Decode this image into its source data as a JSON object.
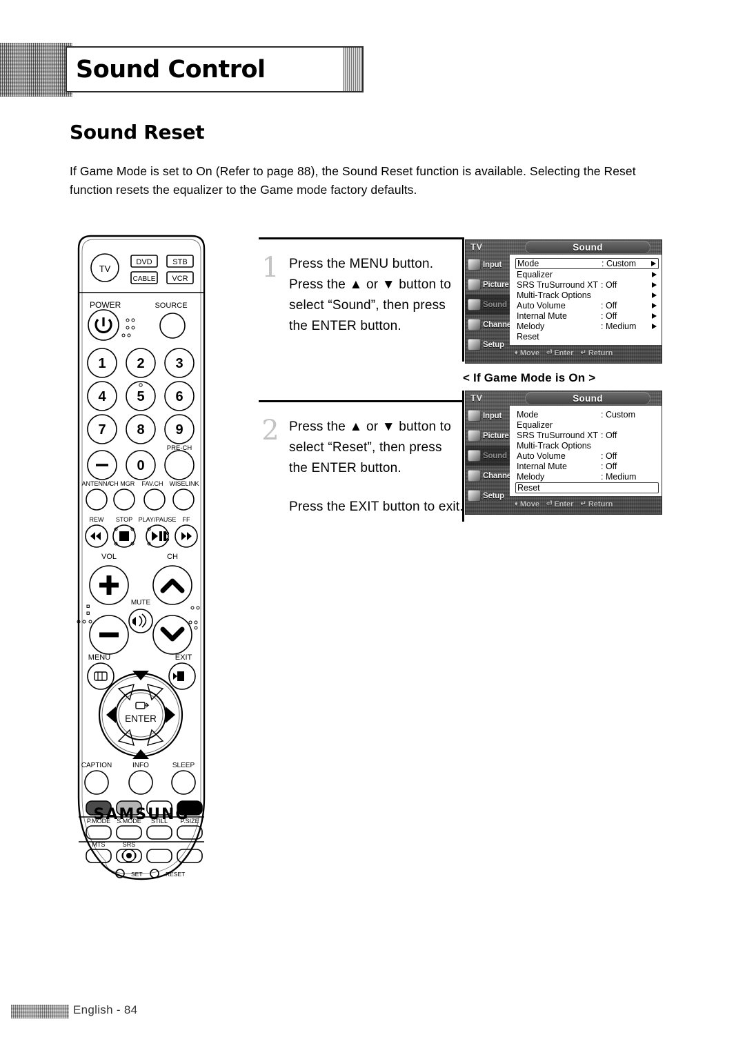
{
  "header": {
    "title": "Sound Control"
  },
  "section": {
    "title": "Sound Reset",
    "intro": "If Game Mode is set to On (Refer to page 88), the Sound Reset function is available. Selecting the Reset function resets the equalizer to the Game mode factory defaults."
  },
  "steps": [
    {
      "number": "1",
      "lines": [
        "Press the MENU button.",
        "Press the ▲ or ▼ button to",
        "select “Sound”, then press",
        "the ENTER button."
      ],
      "extra": ""
    },
    {
      "number": "2",
      "lines": [
        "Press the ▲ or ▼ button to",
        "select “Reset”, then press",
        "the ENTER button."
      ],
      "extra": "Press the EXIT button to exit."
    }
  ],
  "osd_caption": "< If Game Mode is On >",
  "osd": {
    "tv_label": "TV",
    "title": "Sound",
    "sidebar": [
      {
        "label": "Input",
        "icon": "input-icon",
        "selected": false
      },
      {
        "label": "Picture",
        "icon": "picture-icon",
        "selected": false
      },
      {
        "label": "Sound",
        "icon": "sound-icon",
        "selected": true
      },
      {
        "label": "Channel",
        "icon": "channel-icon",
        "selected": false
      },
      {
        "label": "Setup",
        "icon": "setup-icon",
        "selected": false
      }
    ],
    "bottom_bar": [
      {
        "glyph": "♦",
        "label": "Move"
      },
      {
        "glyph": "⏎",
        "label": "Enter"
      },
      {
        "glyph": "↵",
        "label": "Return"
      }
    ],
    "menu_1": {
      "rows": [
        {
          "label": "Mode",
          "value": ": Custom",
          "arrow": true,
          "boxed": true
        },
        {
          "label": "Equalizer",
          "value": "",
          "arrow": true,
          "boxed": false
        },
        {
          "label": "SRS TruSurround XT",
          "value": ": Off",
          "arrow": true,
          "boxed": false
        },
        {
          "label": "Multi-Track Options",
          "value": "",
          "arrow": true,
          "boxed": false
        },
        {
          "label": "Auto Volume",
          "value": ": Off",
          "arrow": true,
          "boxed": false
        },
        {
          "label": "Internal Mute",
          "value": ": Off",
          "arrow": true,
          "boxed": false
        },
        {
          "label": "Melody",
          "value": ": Medium",
          "arrow": true,
          "boxed": false
        },
        {
          "label": "Reset",
          "value": "",
          "arrow": false,
          "boxed": false
        }
      ]
    },
    "menu_2": {
      "rows": [
        {
          "label": "Mode",
          "value": ": Custom",
          "arrow": false,
          "boxed": false
        },
        {
          "label": "Equalizer",
          "value": "",
          "arrow": false,
          "boxed": false
        },
        {
          "label": "SRS TruSurround XT",
          "value": ": Off",
          "arrow": false,
          "boxed": false
        },
        {
          "label": "Multi-Track Options",
          "value": "",
          "arrow": false,
          "boxed": false
        },
        {
          "label": "Auto Volume",
          "value": ": Off",
          "arrow": false,
          "boxed": false
        },
        {
          "label": "Internal Mute",
          "value": ": Off",
          "arrow": false,
          "boxed": false
        },
        {
          "label": "Melody",
          "value": ": Medium",
          "arrow": false,
          "boxed": false
        },
        {
          "label": "Reset",
          "value": "",
          "arrow": false,
          "boxed": true
        }
      ]
    }
  },
  "remote": {
    "brand": "SAMSUNG",
    "device_buttons": [
      "TV",
      "DVD",
      "STB",
      "CABLE",
      "VCR"
    ],
    "power_label": "POWER",
    "source_label": "SOURCE",
    "keypad": [
      "1",
      "2",
      "3",
      "4",
      "5",
      "6",
      "7",
      "8",
      "9",
      "—",
      "0",
      ""
    ],
    "prech_label": "PRE-CH",
    "feature_row": [
      "ANTENNA",
      "CH MGR",
      "FAV.CH",
      "WISELINK"
    ],
    "transport": [
      "REW",
      "STOP",
      "PLAY/PAUSE",
      "FF"
    ],
    "vol_label": "VOL",
    "ch_label": "CH",
    "mute_label": "MUTE",
    "menu_label": "MENU",
    "exit_label": "EXIT",
    "enter_label": "ENTER",
    "bottom_row": [
      "CAPTION",
      "INFO",
      "SLEEP"
    ],
    "mode_row": [
      "P.MODE",
      "S.MODE",
      "STILL",
      "P.SIZE"
    ],
    "mts_label": "MTS",
    "srs_label": "SRS",
    "set_label": "SET",
    "reset_label": "RESET"
  },
  "footer": {
    "text": "English - 84"
  },
  "colors": {
    "ink": "#000000",
    "osd_panel": "#ffffff",
    "osd_chrome": "#4a4a4a",
    "muted": "#b9b9b9"
  }
}
